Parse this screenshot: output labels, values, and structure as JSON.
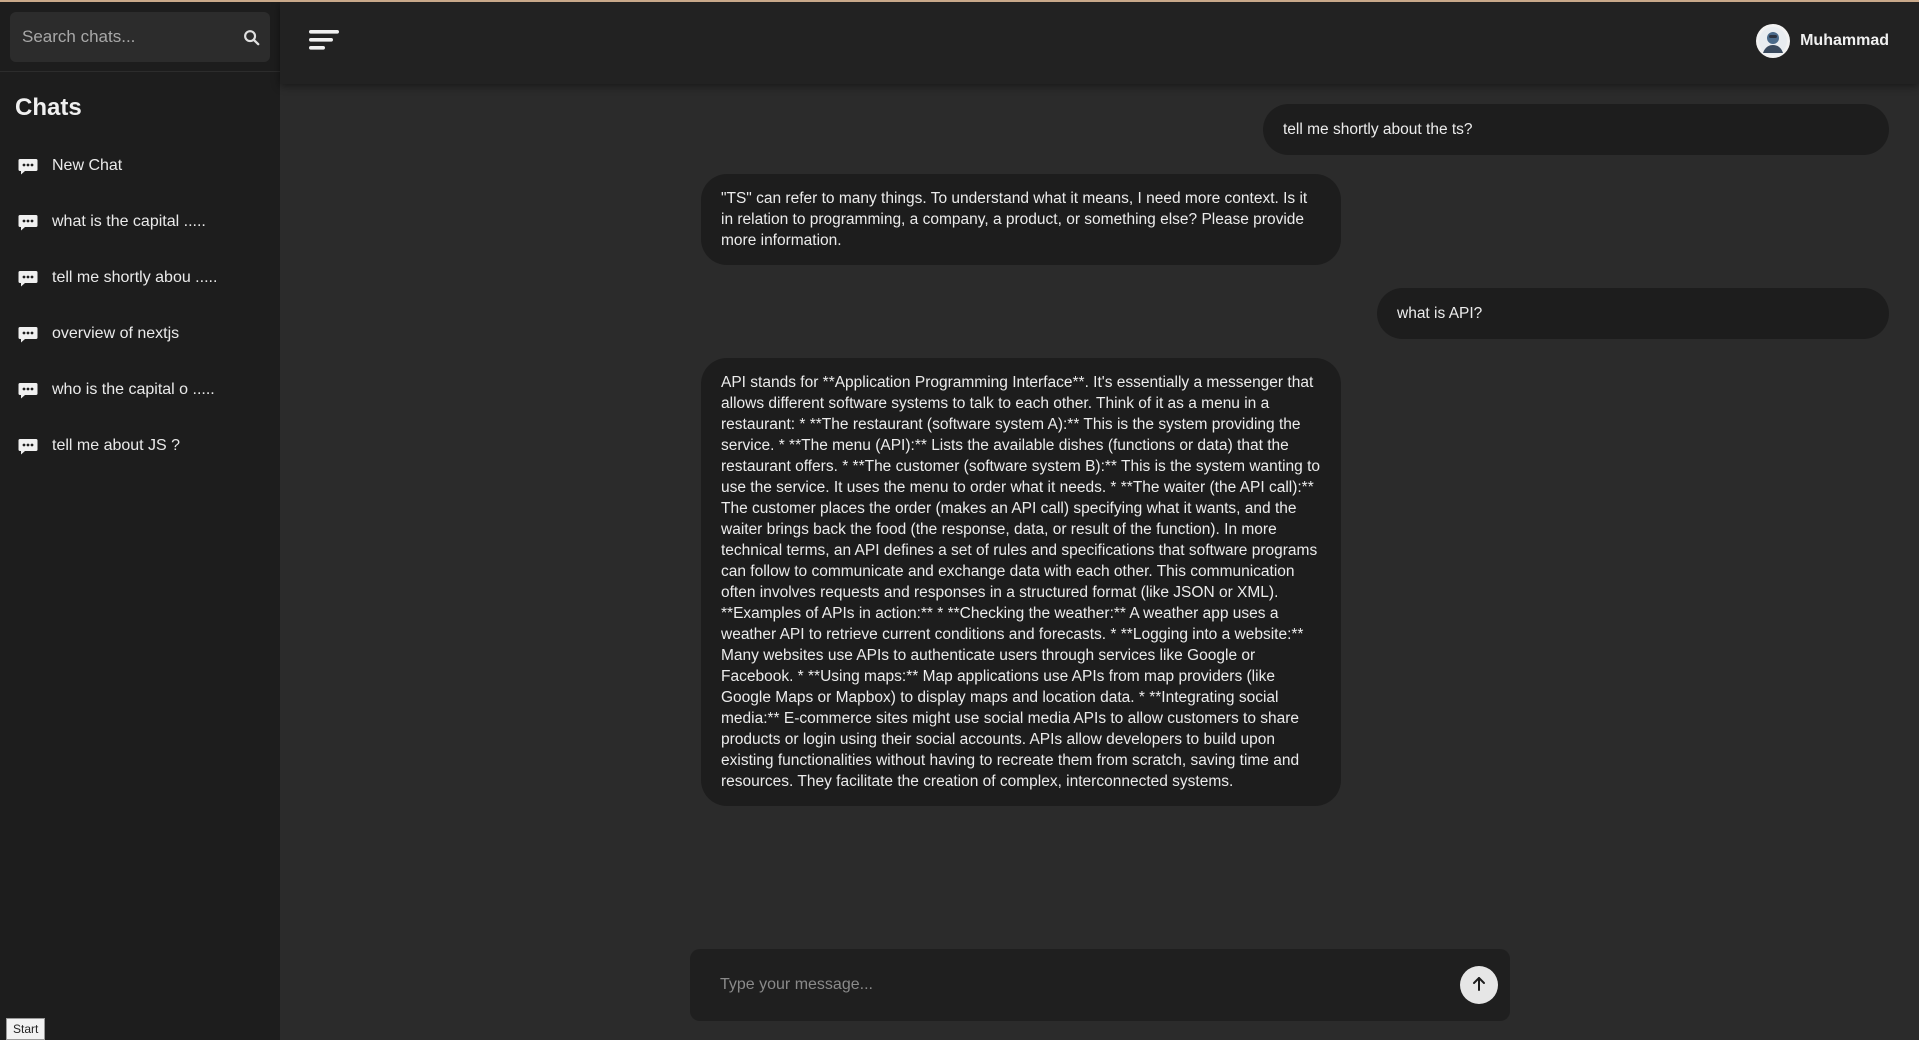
{
  "sidebar": {
    "search": {
      "placeholder": "Search chats..."
    },
    "title": "Chats",
    "items": [
      {
        "label": "New Chat"
      },
      {
        "label": "what is the capital ....."
      },
      {
        "label": "tell me shortly abou ....."
      },
      {
        "label": "overview of nextjs"
      },
      {
        "label": "who is the capital o ....."
      },
      {
        "label": "tell me about JS ?"
      }
    ]
  },
  "taskbar": {
    "start_label": "Start"
  },
  "header": {
    "user_name": "Muhammad"
  },
  "messages": [
    {
      "role": "user",
      "text": "tell me shortly about the ts?"
    },
    {
      "role": "assistant",
      "text": "\"TS\" can refer to many things. To understand what it means, I need more context. Is it in relation to programming, a company, a product, or something else? Please provide more information."
    },
    {
      "role": "user",
      "text": "what is API?"
    },
    {
      "role": "assistant",
      "text": "API stands for **Application Programming Interface**. It's essentially a messenger that allows different software systems to talk to each other. Think of it as a menu in a restaurant: * **The restaurant (software system A):** This is the system providing the service. * **The menu (API):** Lists the available dishes (functions or data) that the restaurant offers. * **The customer (software system B):** This is the system wanting to use the service. It uses the menu to order what it needs. * **The waiter (the API call):** The customer places the order (makes an API call) specifying what it wants, and the waiter brings back the food (the response, data, or result of the function). In more technical terms, an API defines a set of rules and specifications that software programs can follow to communicate and exchange data with each other. This communication often involves requests and responses in a structured format (like JSON or XML). **Examples of APIs in action:** * **Checking the weather:** A weather app uses a weather API to retrieve current conditions and forecasts. * **Logging into a website:** Many websites use APIs to authenticate users through services like Google or Facebook. * **Using maps:** Map applications use APIs from map providers (like Google Maps or Mapbox) to display maps and location data. * **Integrating social media:** E-commerce sites might use social media APIs to allow customers to share products or login using their social accounts. APIs allow developers to build upon existing functionalities without having to recreate them from scratch, saving time and resources. They facilitate the creation of complex, interconnected systems."
    }
  ],
  "composer": {
    "placeholder": "Type your message..."
  }
}
